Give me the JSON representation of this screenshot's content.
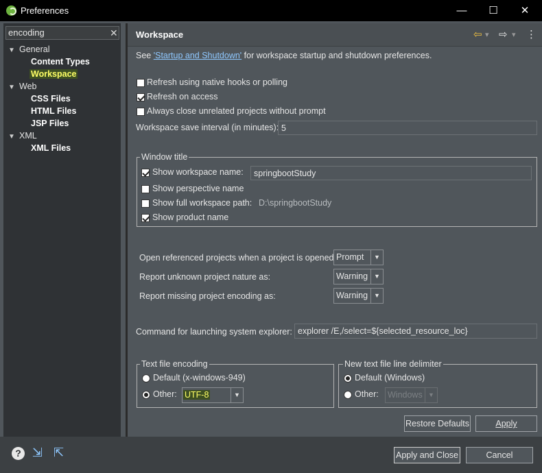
{
  "window": {
    "title": "Preferences",
    "minimize": "—",
    "maximize": "☐",
    "close": "✕"
  },
  "filter": {
    "value": "encoding",
    "clear": "✕"
  },
  "tree": {
    "general": "General",
    "content_types": "Content Types",
    "workspace": "Workspace",
    "web": "Web",
    "css_files": "CSS Files",
    "html_files": "HTML Files",
    "jsp_files": "JSP Files",
    "xml": "XML",
    "xml_files": "XML Files"
  },
  "page": {
    "title": "Workspace",
    "see_prefix": "See ",
    "see_link": "'Startup and Shutdown'",
    "see_suffix": " for workspace startup and shutdown preferences.",
    "refresh_native": "Refresh using native hooks or polling",
    "refresh_access": "Refresh on access",
    "always_close": "Always close unrelated projects without prompt",
    "save_interval_label": "Workspace save interval (in minutes):",
    "save_interval_value": "5"
  },
  "window_title_group": {
    "legend": "Window title",
    "show_workspace_name": "Show workspace name:",
    "workspace_name_value": "springbootStudy",
    "show_perspective": "Show perspective name",
    "show_full_path": "Show full workspace path:",
    "full_path_value": "D:\\springbootStudy",
    "show_product": "Show product name"
  },
  "projects": {
    "open_referenced_label": "Open referenced projects when a project is opened:",
    "open_referenced_value": "Prompt",
    "unknown_nature_label": "Report unknown project nature as:",
    "unknown_nature_value": "Warning",
    "missing_encoding_label": "Report missing project encoding as:",
    "missing_encoding_value": "Warning"
  },
  "explorer": {
    "label": "Command for launching system explorer:",
    "value": "explorer /E,/select=${selected_resource_loc}"
  },
  "encoding": {
    "legend": "Text file encoding",
    "default_label": "Default (x-windows-949)",
    "other_label": "Other:",
    "other_value": "UTF-8"
  },
  "delimiter": {
    "legend": "New text file line delimiter",
    "default_label": "Default (Windows)",
    "other_label": "Other:",
    "other_value": "Windows"
  },
  "buttons": {
    "restore_defaults": "Restore Defaults",
    "apply": "Apply",
    "apply_close": "Apply and Close",
    "cancel": "Cancel"
  },
  "icons": {
    "help": "?",
    "import": "⇲",
    "export": "⇱",
    "back": "⇦",
    "forward": "⇨",
    "menu": "⋮",
    "dropdown": "▾"
  },
  "colors": {
    "highlight_bg": "#3d4f23",
    "highlight_fg": "#ffff66",
    "link": "#8fc8ff"
  }
}
